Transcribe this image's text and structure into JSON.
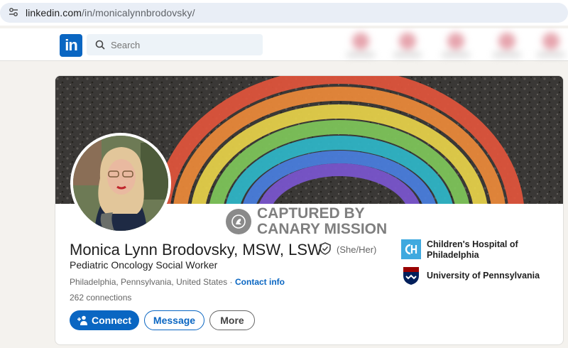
{
  "browser": {
    "url_prefix": "linkedin.com",
    "url_path": "/in/monicalynnbrodovsky/"
  },
  "nav": {
    "logo_text": "in",
    "search_placeholder": "Search"
  },
  "watermark": {
    "line1": "CAPTURED BY",
    "line2": "CANARY MISSION"
  },
  "profile": {
    "name": "Monica Lynn Brodovsky, MSW, LSW",
    "pronouns": "(She/Her)",
    "headline": "Pediatric Oncology Social Worker",
    "location": "Philadelphia, Pennsylvania, United States",
    "separator": "·",
    "contact_info": "Contact info",
    "connections": "262 connections"
  },
  "actions": {
    "connect": "Connect",
    "message": "Message",
    "more": "More"
  },
  "orgs": [
    {
      "name": "Children's Hospital of Philadelphia",
      "logo": "chop-logo",
      "color": "#3fa9df"
    },
    {
      "name": "University of Pennsylvania",
      "logo": "penn-shield-logo",
      "color": "#011f5b"
    }
  ],
  "colors": {
    "accent": "#0a66c2",
    "banner_bg": "#3b3937"
  }
}
